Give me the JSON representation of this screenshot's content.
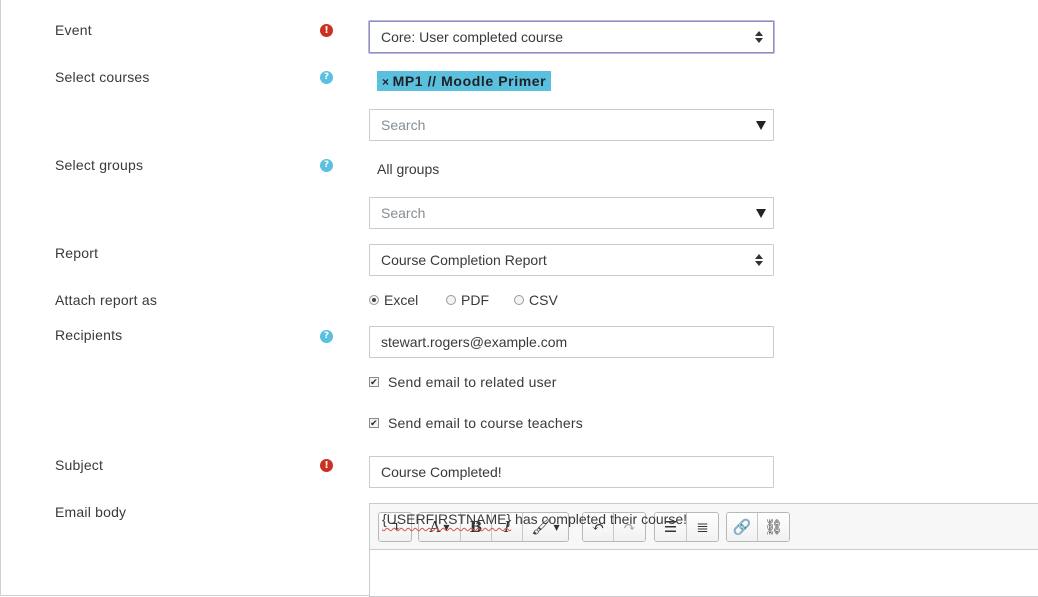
{
  "labels": {
    "event": "Event",
    "select_courses": "Select courses",
    "select_groups": "Select groups",
    "report": "Report",
    "attach_as": "Attach report as",
    "recipients": "Recipients",
    "subject": "Subject",
    "email_body": "Email body"
  },
  "icons": {
    "required": "!",
    "help": "?"
  },
  "event": {
    "value": "Core: User completed course"
  },
  "courses": {
    "selected_tag": "MP1 // Moodle Primer",
    "remove_glyph": "×",
    "search_placeholder": "Search"
  },
  "groups": {
    "value": "All groups",
    "search_placeholder": "Search"
  },
  "report": {
    "value": "Course Completion Report"
  },
  "attach": {
    "options": [
      "Excel",
      "PDF",
      "CSV"
    ],
    "selected": "Excel"
  },
  "recipients": {
    "value": "stewart.rogers@example.com",
    "send_related_user": "Send email to related user",
    "send_course_teachers": "Send email to course teachers"
  },
  "subject": {
    "value": "Course Completed!"
  },
  "editor": {
    "body_placeholder_token": "{USERFIRSTNAME}",
    "body_rest": " has completed their course!",
    "colors": {
      "toolbar_bg": "#f7f7f7"
    }
  },
  "colors": {
    "required": "#ca3120",
    "help": "#5bc0de",
    "tag_bg": "#5bc0de",
    "focus_ring": "#b9b4ff"
  }
}
